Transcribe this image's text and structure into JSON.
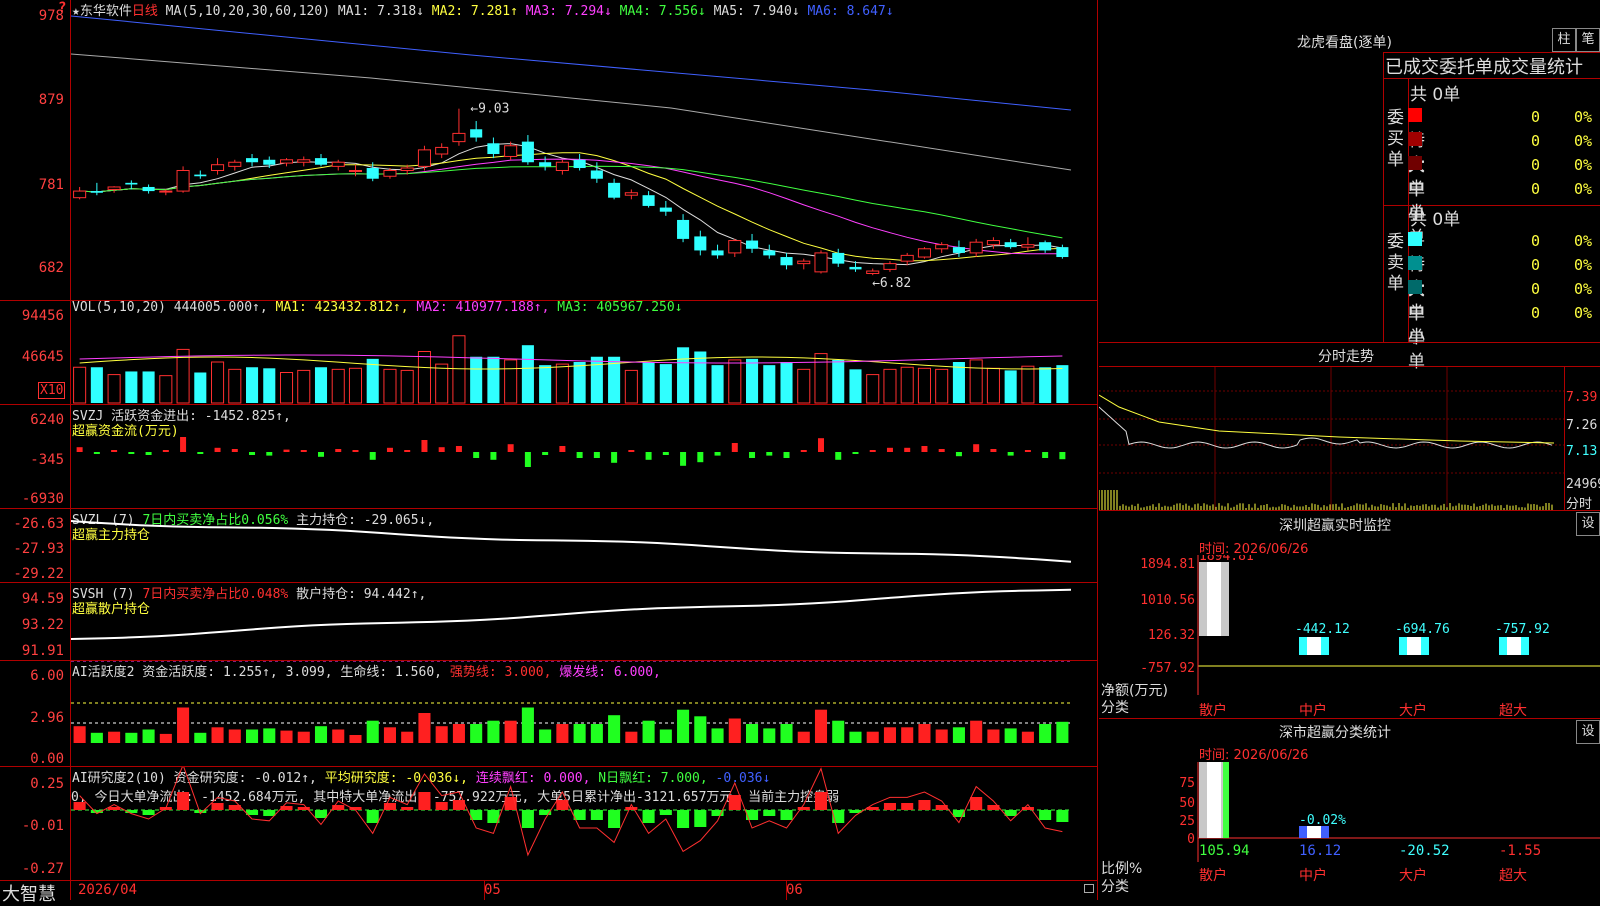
{
  "main": {
    "stock_label": "★东华软件",
    "period_label": "日线",
    "ma_header": {
      "label": "MA(5,10,20,30,60,120)",
      "items": [
        {
          "text": "MA1: 7.318↓",
          "color": "#dddddd"
        },
        {
          "text": "MA2: 7.281↑",
          "color": "#ffff40"
        },
        {
          "text": "MA3: 7.294↓",
          "color": "#ff40ff"
        },
        {
          "text": "MA4: 7.556↓",
          "color": "#40ff40"
        },
        {
          "text": "MA5: 7.940↓",
          "color": "#dddddd"
        },
        {
          "text": "MA6: 8.647↓",
          "color": "#4060ff"
        }
      ]
    },
    "yaxis": [
      "978",
      "879",
      "781",
      "682"
    ],
    "high_label": "9.03",
    "low_label": "6.82",
    "colors": {
      "up": "#ff3030",
      "down": "#30ffff",
      "grid": "#b00000"
    }
  },
  "vol": {
    "header": [
      {
        "text": "VOL(5,10,20)",
        "color": "#dddddd"
      },
      {
        "text": "444005.000↑,",
        "color": "#dddddd"
      },
      {
        "text": "MA1: 423432.812↑,",
        "color": "#ffff40"
      },
      {
        "text": "MA2: 410977.188↑,",
        "color": "#ff40ff"
      },
      {
        "text": "MA3: 405967.250↓",
        "color": "#40ff40"
      }
    ],
    "yaxis": [
      "94456",
      "46645"
    ],
    "unit": "X10"
  },
  "svzj": {
    "header": [
      {
        "text": "SVZJ  活跃资金进出: -1452.825↑,",
        "color": "#dddddd"
      }
    ],
    "subtitle": "超赢资金流(万元)",
    "yaxis": [
      "6240",
      "-345",
      "-6930"
    ]
  },
  "svzl": {
    "header": [
      {
        "text": "SVZL (7)",
        "color": "#dddddd"
      },
      {
        "text": "7日内买卖净占比0.056%",
        "color": "#40ff40"
      },
      {
        "text": "主力持仓: -29.065↓,",
        "color": "#dddddd"
      }
    ],
    "subtitle": "超赢主力持仓",
    "yaxis": [
      "-26.63",
      "-27.93",
      "-29.22"
    ]
  },
  "svsh": {
    "header": [
      {
        "text": "SVSH (7)",
        "color": "#dddddd"
      },
      {
        "text": "7日内买卖净占比0.048%",
        "color": "#ff3030"
      },
      {
        "text": "散户持仓: 94.442↑,",
        "color": "#dddddd"
      }
    ],
    "subtitle": "超赢散户持仓",
    "yaxis": [
      "94.59",
      "93.22",
      "91.91"
    ]
  },
  "ai_active": {
    "header": [
      {
        "text": "AI活跃度2 资金活跃度: 1.255↑, 3.099, 生命线: 1.560,",
        "color": "#dddddd"
      },
      {
        "text": "强势线: 3.000,",
        "color": "#ff3030"
      },
      {
        "text": "爆发线: 6.000,",
        "color": "#ff40ff"
      }
    ],
    "yaxis": [
      "6.00",
      "2.96",
      "0.00"
    ]
  },
  "ai_research": {
    "header": [
      {
        "text": "AI研究度2(10) 资金研究度: -0.012↑,",
        "color": "#dddddd"
      },
      {
        "text": "平均研究度: -0.036↓,",
        "color": "#ffff40"
      },
      {
        "text": "连续飘红: 0.000,",
        "color": "#ff40ff"
      },
      {
        "text": "N日飘红: 7.000,",
        "color": "#40ff40"
      },
      {
        "text": "-0.036↓",
        "color": "#4060ff"
      }
    ],
    "line2": "0, 今日大单净流出: -1452.684万元, 其中特大单净流出: -757.922万元, 大单5日累计净出-3121.657万元, 当前主力控盘弱",
    "yaxis": [
      "0.25",
      "-0.01",
      "-0.27"
    ]
  },
  "footer": {
    "brand": "大智慧",
    "dates": [
      "2026/04",
      "05",
      "06"
    ]
  },
  "lhkp": {
    "title": "龙虎看盘(逐单)",
    "btn1": "柱",
    "btn2": "笔",
    "tabs": "已成交委托单成交量统计",
    "buy_side_label": "委买单",
    "sell_side_label": "委卖单",
    "buy_total": "共 0单",
    "sell_total": "共 0单",
    "buy_rows": [
      {
        "label": "特大",
        "count": "0",
        "pct": "0%",
        "color": "#ff0000"
      },
      {
        "label": "大单",
        "count": "0",
        "pct": "0%",
        "color": "#a00000"
      },
      {
        "label": "中单",
        "count": "0",
        "pct": "0%",
        "color": "#700000"
      },
      {
        "label": "小单",
        "count": "0",
        "pct": "0%",
        "color": ""
      }
    ],
    "sell_rows": [
      {
        "label": "特大",
        "count": "0",
        "pct": "0%",
        "color": "#30ffff"
      },
      {
        "label": "大单",
        "count": "0",
        "pct": "0%",
        "color": "#009090"
      },
      {
        "label": "中单",
        "count": "0",
        "pct": "0%",
        "color": "#006a6a"
      },
      {
        "label": "小单",
        "count": "0",
        "pct": "0%",
        "color": ""
      }
    ]
  },
  "fenshi": {
    "title": "分时走势",
    "yaxis": [
      "7.39",
      "7.26",
      "7.13"
    ],
    "vol_label": "24969",
    "unit": "分时"
  },
  "sz_monitor": {
    "title": "深圳超赢实时监控",
    "btn": "设",
    "time": "时间: 2026/06/26",
    "yaxis": [
      "1894.81",
      "1010.56",
      "126.32",
      "-757.92"
    ],
    "values": [
      {
        "cat": "散户",
        "value": 1894.81,
        "label": "1894.81"
      },
      {
        "cat": "中户",
        "value": -442.12,
        "label": "-442.12"
      },
      {
        "cat": "大户",
        "value": -694.76,
        "label": "-694.76"
      },
      {
        "cat": "超大",
        "value": -757.92,
        "label": "-757.92"
      }
    ],
    "axis_title": "净额(万元)",
    "axis_title2": "分类"
  },
  "sz_class": {
    "title": "深市超赢分类统计",
    "btn": "设",
    "time": "时间: 2026/06/26",
    "yaxis": [
      "75",
      "50",
      "25",
      "0"
    ],
    "mid_label": "-0.02%",
    "values": [
      {
        "cat": "散户",
        "value": "105.94",
        "color": "#40ff40"
      },
      {
        "cat": "中户",
        "value": "16.12",
        "color": "#4060ff"
      },
      {
        "cat": "大户",
        "value": "-20.52",
        "color": "#40ffff"
      },
      {
        "cat": "超大",
        "value": "-1.55",
        "color": "#ff3030"
      }
    ],
    "axis_title": "比例%",
    "axis_title2": "分类"
  },
  "chart_data": {
    "type": "candlestick",
    "dates_shown": [
      "2026/04",
      "05",
      "06"
    ],
    "ohlc": [
      [
        7.72,
        7.85,
        7.7,
        7.8
      ],
      [
        7.8,
        7.9,
        7.75,
        7.78
      ],
      [
        7.82,
        7.86,
        7.78,
        7.85
      ],
      [
        7.9,
        7.93,
        7.82,
        7.88
      ],
      [
        7.85,
        7.88,
        7.77,
        7.8
      ],
      [
        7.79,
        7.82,
        7.75,
        7.8
      ],
      [
        7.8,
        8.1,
        7.78,
        8.05
      ],
      [
        8.0,
        8.05,
        7.95,
        7.98
      ],
      [
        8.05,
        8.2,
        8.0,
        8.12
      ],
      [
        8.1,
        8.18,
        8.05,
        8.15
      ],
      [
        8.2,
        8.25,
        8.1,
        8.15
      ],
      [
        8.18,
        8.22,
        8.08,
        8.12
      ],
      [
        8.14,
        8.2,
        8.1,
        8.18
      ],
      [
        8.15,
        8.22,
        8.1,
        8.18
      ],
      [
        8.2,
        8.25,
        8.1,
        8.12
      ],
      [
        8.1,
        8.18,
        8.05,
        8.15
      ],
      [
        8.05,
        8.12,
        7.98,
        8.05
      ],
      [
        8.08,
        8.15,
        7.92,
        7.95
      ],
      [
        7.98,
        8.08,
        7.95,
        8.05
      ],
      [
        8.05,
        8.12,
        8.0,
        8.08
      ],
      [
        8.1,
        8.35,
        8.05,
        8.3
      ],
      [
        8.25,
        8.38,
        8.2,
        8.33
      ],
      [
        8.4,
        8.8,
        8.35,
        8.5
      ],
      [
        8.55,
        8.65,
        8.4,
        8.45
      ],
      [
        8.38,
        8.45,
        8.2,
        8.25
      ],
      [
        8.22,
        8.4,
        8.18,
        8.35
      ],
      [
        8.4,
        8.48,
        8.12,
        8.15
      ],
      [
        8.15,
        8.22,
        8.05,
        8.1
      ],
      [
        8.05,
        8.18,
        8.0,
        8.15
      ],
      [
        8.18,
        8.25,
        8.05,
        8.08
      ],
      [
        8.05,
        8.15,
        7.9,
        7.95
      ],
      [
        7.9,
        7.95,
        7.7,
        7.72
      ],
      [
        7.75,
        7.82,
        7.7,
        7.78
      ],
      [
        7.75,
        7.8,
        7.6,
        7.62
      ],
      [
        7.6,
        7.68,
        7.5,
        7.55
      ],
      [
        7.45,
        7.52,
        7.18,
        7.22
      ],
      [
        7.25,
        7.32,
        7.02,
        7.08
      ],
      [
        7.08,
        7.15,
        6.98,
        7.02
      ],
      [
        7.05,
        7.22,
        7.0,
        7.2
      ],
      [
        7.2,
        7.28,
        7.05,
        7.1
      ],
      [
        7.08,
        7.15,
        6.98,
        7.02
      ],
      [
        7.0,
        7.05,
        6.85,
        6.9
      ],
      [
        6.92,
        6.98,
        6.85,
        6.95
      ],
      [
        6.82,
        7.08,
        6.8,
        7.05
      ],
      [
        7.05,
        7.1,
        6.88,
        6.92
      ],
      [
        6.88,
        6.95,
        6.82,
        6.85
      ],
      [
        6.8,
        6.86,
        6.78,
        6.83
      ],
      [
        6.85,
        6.95,
        6.82,
        6.92
      ],
      [
        6.95,
        7.05,
        6.9,
        7.02
      ],
      [
        7.0,
        7.12,
        6.98,
        7.1
      ],
      [
        7.1,
        7.18,
        7.05,
        7.15
      ],
      [
        7.12,
        7.2,
        7.0,
        7.05
      ],
      [
        7.05,
        7.22,
        7.0,
        7.18
      ],
      [
        7.15,
        7.24,
        7.1,
        7.2
      ],
      [
        7.18,
        7.22,
        7.1,
        7.12
      ],
      [
        7.12,
        7.24,
        7.08,
        7.15
      ],
      [
        7.18,
        7.2,
        7.05,
        7.08
      ],
      [
        7.12,
        7.15,
        6.98,
        7.0
      ]
    ]
  }
}
